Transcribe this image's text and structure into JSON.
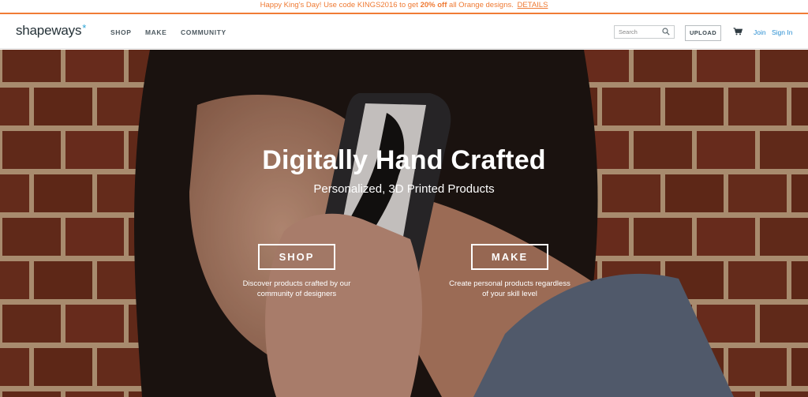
{
  "promo": {
    "text_before": "Happy King's Day! Use code KINGS2016 to get ",
    "highlight": "20% off",
    "text_after": " all Orange designs.",
    "link": "DETAILS",
    "color": "#ef7a33"
  },
  "header": {
    "logo_text": "shapeways",
    "logo_mark": "*",
    "nav": [
      "SHOP",
      "MAKE",
      "COMMUNITY"
    ],
    "search_placeholder": "Search",
    "upload_label": "UPLOAD",
    "join_label": "Join",
    "signin_label": "Sign In",
    "accent_color": "#2a8fd2"
  },
  "hero": {
    "title": "Digitally Hand Crafted",
    "subtitle": "Personalized, 3D Printed Products",
    "shop_button": "SHOP",
    "shop_desc_line1": "Discover products crafted by our",
    "shop_desc_line2": "community of designers",
    "make_button": "MAKE",
    "make_desc_line1": "Create personal products regardless",
    "make_desc_line2": "of your skill level"
  },
  "icons": [
    "search-icon",
    "cart-icon"
  ]
}
